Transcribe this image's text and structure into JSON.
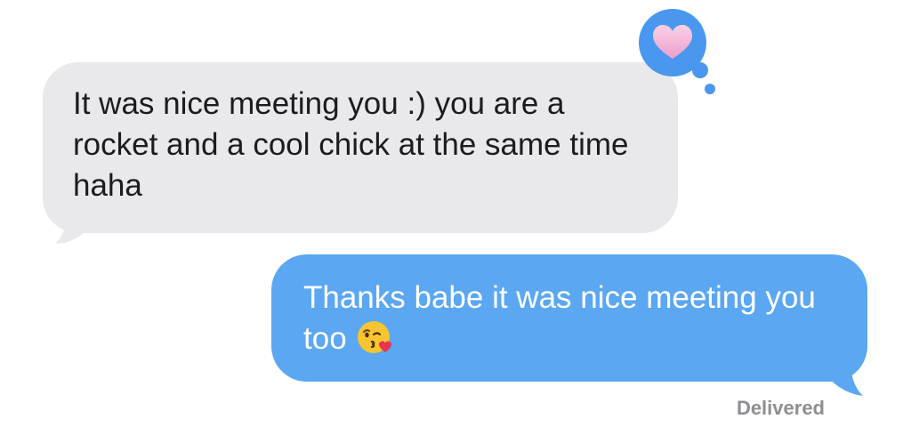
{
  "messages": [
    {
      "direction": "incoming",
      "text": "It was nice meeting you :) you are a rocket and a cool chick at the same time haha",
      "reaction": "heart-icon"
    },
    {
      "direction": "outgoing",
      "text": "Thanks babe it was nice meeting you too",
      "emoji": "kissing-face-with-heart-icon"
    }
  ],
  "status": {
    "delivered_label": "Delivered"
  },
  "colors": {
    "incoming_bubble": "#e9e9eb",
    "outgoing_bubble": "#5ba7f2",
    "tapback_bubble": "#4a97f0",
    "heart": "#f3b2d6",
    "status_text": "#8e8e93"
  }
}
